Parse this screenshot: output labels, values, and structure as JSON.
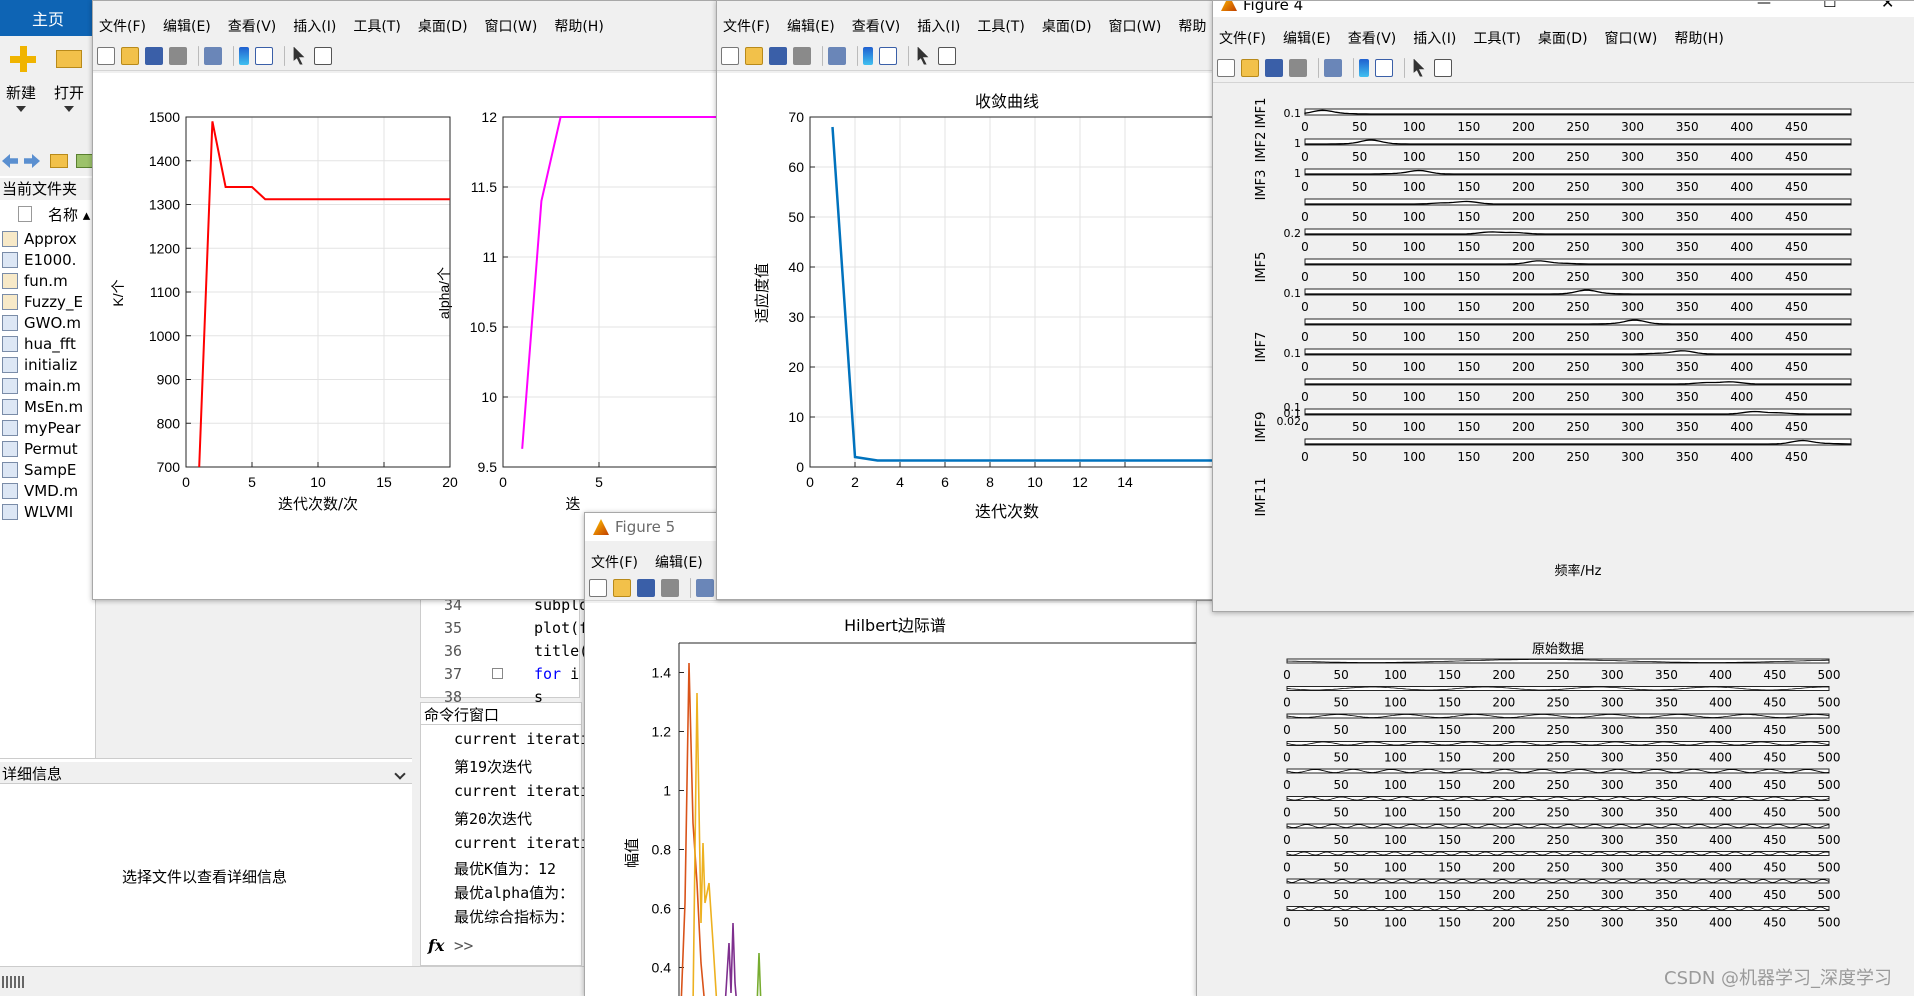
{
  "matlab": {
    "home_tab": "主页",
    "new_label": "新建",
    "open_label": "打开",
    "current_folder_title": "当前文件夹",
    "name_column": "名称 ▴",
    "files": [
      "Approx",
      "E1000.",
      "fun.m",
      "Fuzzy_E",
      "GWO.m",
      "hua_fft",
      "initializ",
      "main.m",
      "MsEn.m",
      "myPear",
      "Permut",
      "SampE",
      "VMD.m",
      "WLVMI"
    ],
    "details_title": "详细信息",
    "details_hint": "选择文件以查看详细信息",
    "editor_line_numbers": [
      "34",
      "35",
      "36",
      "37",
      "38"
    ],
    "editor_code": [
      "subplo",
      "plot(f",
      "title(",
      "for i",
      "    s"
    ],
    "command_window_title": "命令行窗口",
    "command_lines": [
      "current iterati",
      "第19次迭代",
      "current iterati",
      "第20次迭代",
      "current iterati",
      "最优K值为：12",
      "最优alpha值为：",
      "最优综合指标为："
    ],
    "prompt_fx": "fx",
    "prompt": ">>"
  },
  "menus": {
    "full": [
      "文件(F)",
      "编辑(E)",
      "查看(V)",
      "插入(I)",
      "工具(T)",
      "桌面(D)",
      "窗口(W)",
      "帮助(H)"
    ],
    "fig3_partial_last": "帮助",
    "fig5": [
      "文件(F)",
      "编辑(E)"
    ]
  },
  "figure1": {
    "k_plot": {
      "ylabel": "K/个",
      "xlabel": "迭代次数/次",
      "yticks": [
        "1500",
        "1400",
        "1300",
        "1200",
        "1100",
        "1000",
        "900",
        "800",
        "700"
      ],
      "xticks": [
        "0",
        "5",
        "10",
        "15",
        "20"
      ],
      "color": "#ff0000"
    },
    "alpha_plot": {
      "ylabel": "alpha/个",
      "xlabel_partial": "迭",
      "yticks": [
        "12",
        "11.5",
        "11",
        "10.5",
        "10",
        "9.5"
      ],
      "xticks": [
        "0",
        "5"
      ],
      "color": "#ff00ff"
    }
  },
  "figure3": {
    "title": "收敛曲线",
    "ylabel": "适应度值",
    "xlabel": "迭代次数",
    "yticks": [
      "70",
      "60",
      "50",
      "40",
      "30",
      "20",
      "10",
      "0"
    ],
    "xticks": [
      "0",
      "2",
      "4",
      "6",
      "8",
      "10",
      "12",
      "14"
    ],
    "color": "#0072bd"
  },
  "figure4": {
    "window_title": "Figure 4",
    "win_min": "—",
    "win_max": "☐",
    "win_close": "✕",
    "xlabel": "频率/Hz",
    "xticks": [
      "0",
      "50",
      "100",
      "150",
      "200",
      "250",
      "300",
      "350",
      "400",
      "450"
    ],
    "ylabels": [
      "IMF1",
      "IMF2",
      "IMF3",
      "IMF5",
      "IMF7",
      "IMF9",
      "IMF11"
    ],
    "yvals": [
      "0.1",
      "1",
      "1",
      "0.2",
      "0.1",
      "0.1",
      "0.1",
      "0.02"
    ]
  },
  "figure5": {
    "window_title": "Figure 5",
    "title": "Hilbert边际谱",
    "ylabel": "幅值",
    "yticks": [
      "1.4",
      "1.2",
      "1",
      "0.8",
      "0.6",
      "0.4"
    ]
  },
  "raw_figure": {
    "title": "原始数据",
    "xticks": [
      "0",
      "50",
      "100",
      "150",
      "200",
      "250",
      "300",
      "350",
      "400",
      "450",
      "500"
    ]
  },
  "watermark": "CSDN @机器学习_深度学习"
}
